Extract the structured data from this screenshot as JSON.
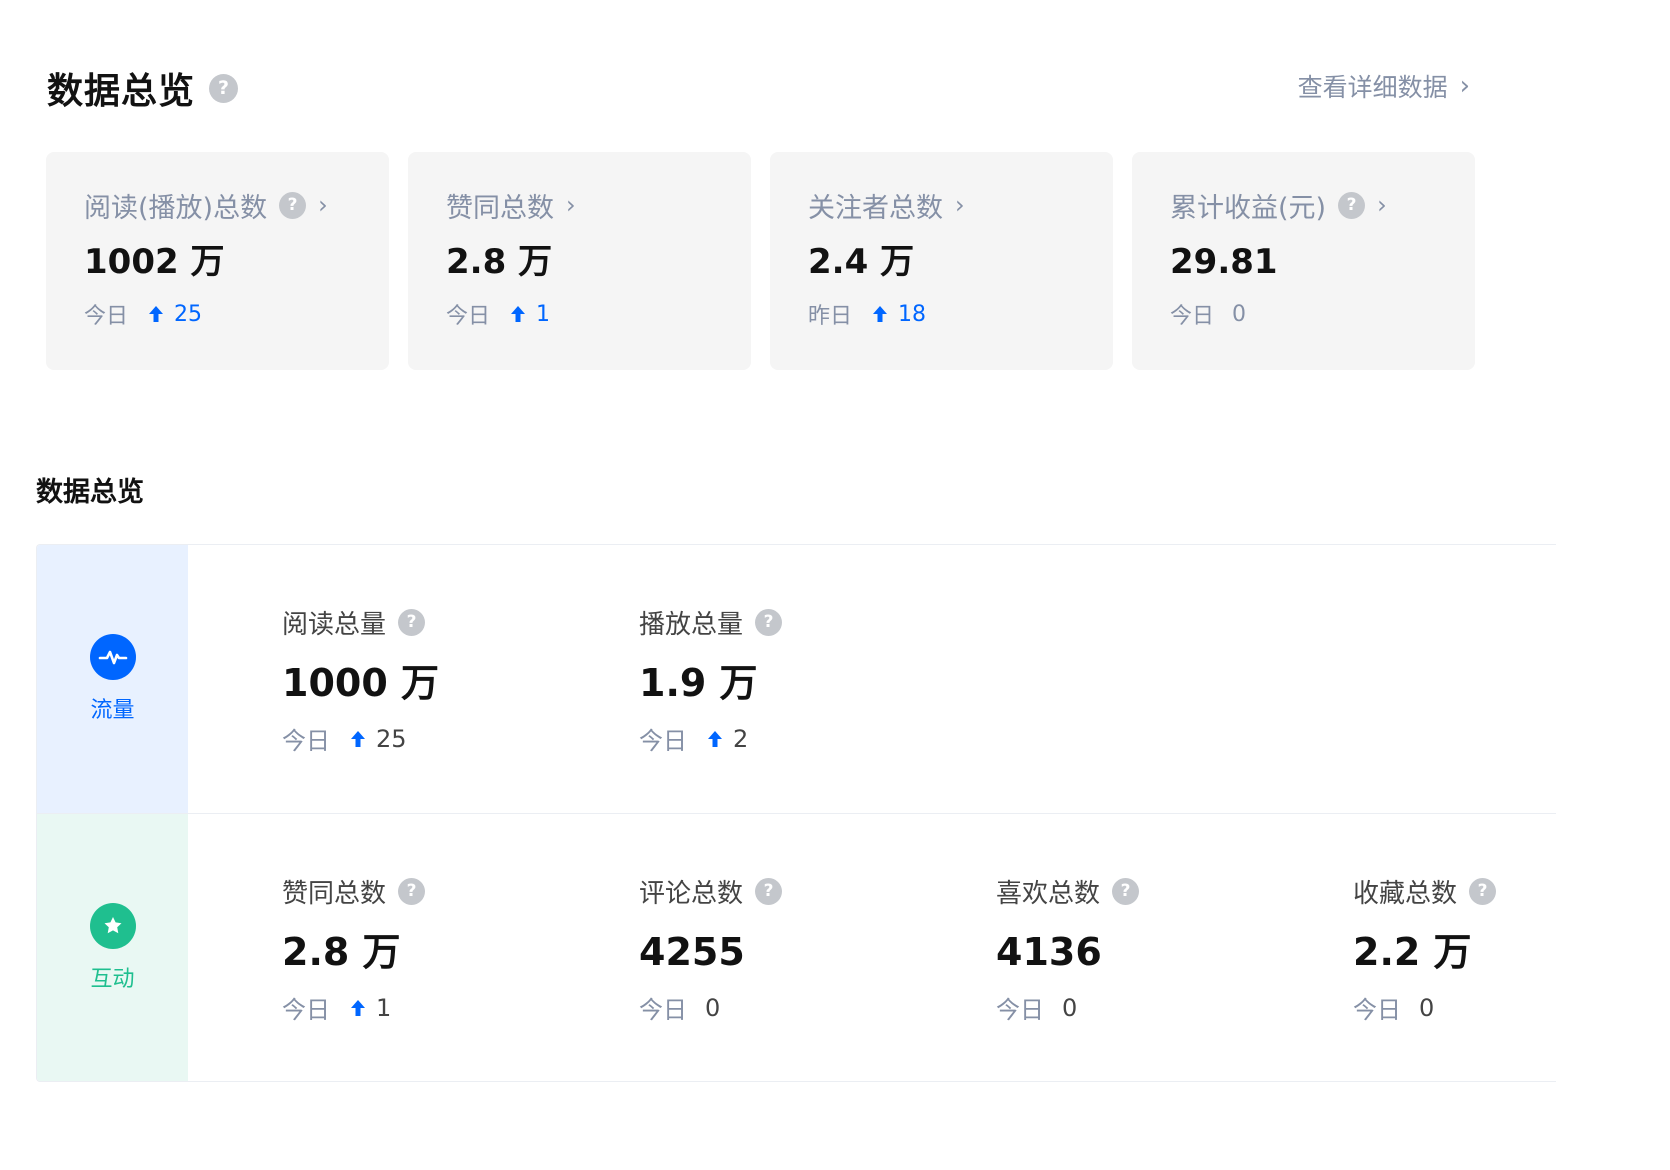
{
  "header": {
    "title": "数据总览",
    "detail_link": "查看详细数据"
  },
  "cards": [
    {
      "label": "阅读(播放)总数",
      "has_help": true,
      "value": "1002 万",
      "foot_label": "今日",
      "trend": "up",
      "delta": "25"
    },
    {
      "label": "赞同总数",
      "has_help": false,
      "value": "2.8 万",
      "foot_label": "今日",
      "trend": "up",
      "delta": "1"
    },
    {
      "label": "关注者总数",
      "has_help": false,
      "value": "2.4 万",
      "foot_label": "昨日",
      "trend": "up",
      "delta": "18"
    },
    {
      "label": "累计收益(元)",
      "has_help": true,
      "value": "29.81",
      "foot_label": "今日",
      "trend": "none",
      "delta": "0"
    }
  ],
  "section": {
    "title": "数据总览",
    "traffic": {
      "label": "流量",
      "icon": "pulse-icon",
      "metrics": [
        {
          "label": "阅读总量",
          "value": "1000 万",
          "foot_label": "今日",
          "trend": "up",
          "delta": "25"
        },
        {
          "label": "播放总量",
          "value": "1.9 万",
          "foot_label": "今日",
          "trend": "up",
          "delta": "2"
        }
      ]
    },
    "interaction": {
      "label": "互动",
      "icon": "star-chat-icon",
      "metrics": [
        {
          "label": "赞同总数",
          "value": "2.8 万",
          "foot_label": "今日",
          "trend": "up",
          "delta": "1"
        },
        {
          "label": "评论总数",
          "value": "4255",
          "foot_label": "今日",
          "trend": "none",
          "delta": "0"
        },
        {
          "label": "喜欢总数",
          "value": "4136",
          "foot_label": "今日",
          "trend": "none",
          "delta": "0"
        },
        {
          "label": "收藏总数",
          "value": "2.2 万",
          "foot_label": "今日",
          "trend": "none",
          "delta": "0"
        }
      ]
    }
  },
  "colors": {
    "accent_blue": "#0066ff",
    "accent_green": "#1fbf8f",
    "muted_text": "#8590a6",
    "card_bg": "#f5f5f5"
  }
}
